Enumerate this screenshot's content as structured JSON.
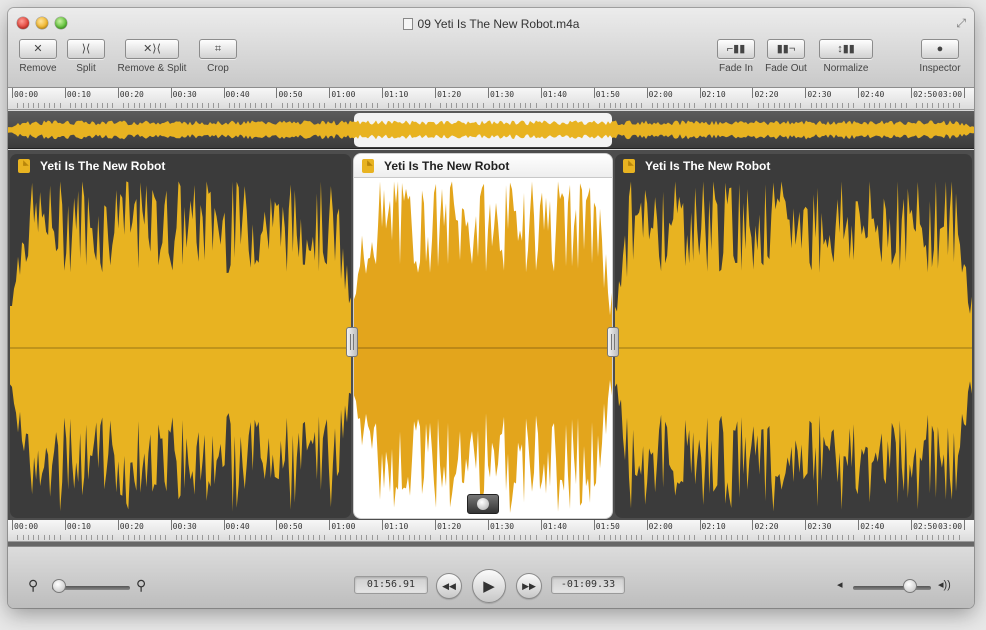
{
  "window": {
    "title": "09 Yeti Is The New Robot.m4a"
  },
  "toolbar": {
    "remove": {
      "label": "Remove",
      "glyph": "✕"
    },
    "split": {
      "label": "Split",
      "glyph": "⟩⟨"
    },
    "remove_split": {
      "label": "Remove & Split",
      "glyph": "✕⟩⟨"
    },
    "crop": {
      "label": "Crop",
      "glyph": "⌗"
    },
    "fade_in": {
      "label": "Fade In",
      "glyph": "⌐▮▮"
    },
    "fade_out": {
      "label": "Fade Out",
      "glyph": "▮▮¬"
    },
    "normalize": {
      "label": "Normalize",
      "glyph": "↕▮▮"
    },
    "inspector": {
      "label": "Inspector",
      "glyph": "●"
    }
  },
  "ruler_labels": [
    "00:00",
    "00:10",
    "00:20",
    "00:30",
    "00:40",
    "00:50",
    "01:00",
    "01:10",
    "01:20",
    "01:30",
    "01:40",
    "01:50",
    "02:00",
    "02:10",
    "02:20",
    "02:30",
    "02:40",
    "02:50",
    "03:00"
  ],
  "clips": [
    {
      "title": "Yeti Is The New Robot",
      "selected": false
    },
    {
      "title": "Yeti Is The New Robot",
      "selected": true
    },
    {
      "title": "Yeti Is The New Robot",
      "selected": false
    }
  ],
  "transport": {
    "current_time": "01:56.91",
    "remaining_time": "-01:09.33",
    "rewind_glyph": "◀◀",
    "play_glyph": "▶",
    "forward_glyph": "▶▶",
    "zoom_out_glyph": "⚲",
    "zoom_in_glyph": "⚲",
    "vol_low_glyph": "◂",
    "vol_high_glyph": "◂))",
    "zoom_level": 0.0,
    "volume_level": 0.78
  },
  "colors": {
    "waveform": "#e8b321",
    "waveform_selected": "#e3a51c",
    "clip_background": "#3b3b3b",
    "clip_selected_background": "#ffffff"
  }
}
